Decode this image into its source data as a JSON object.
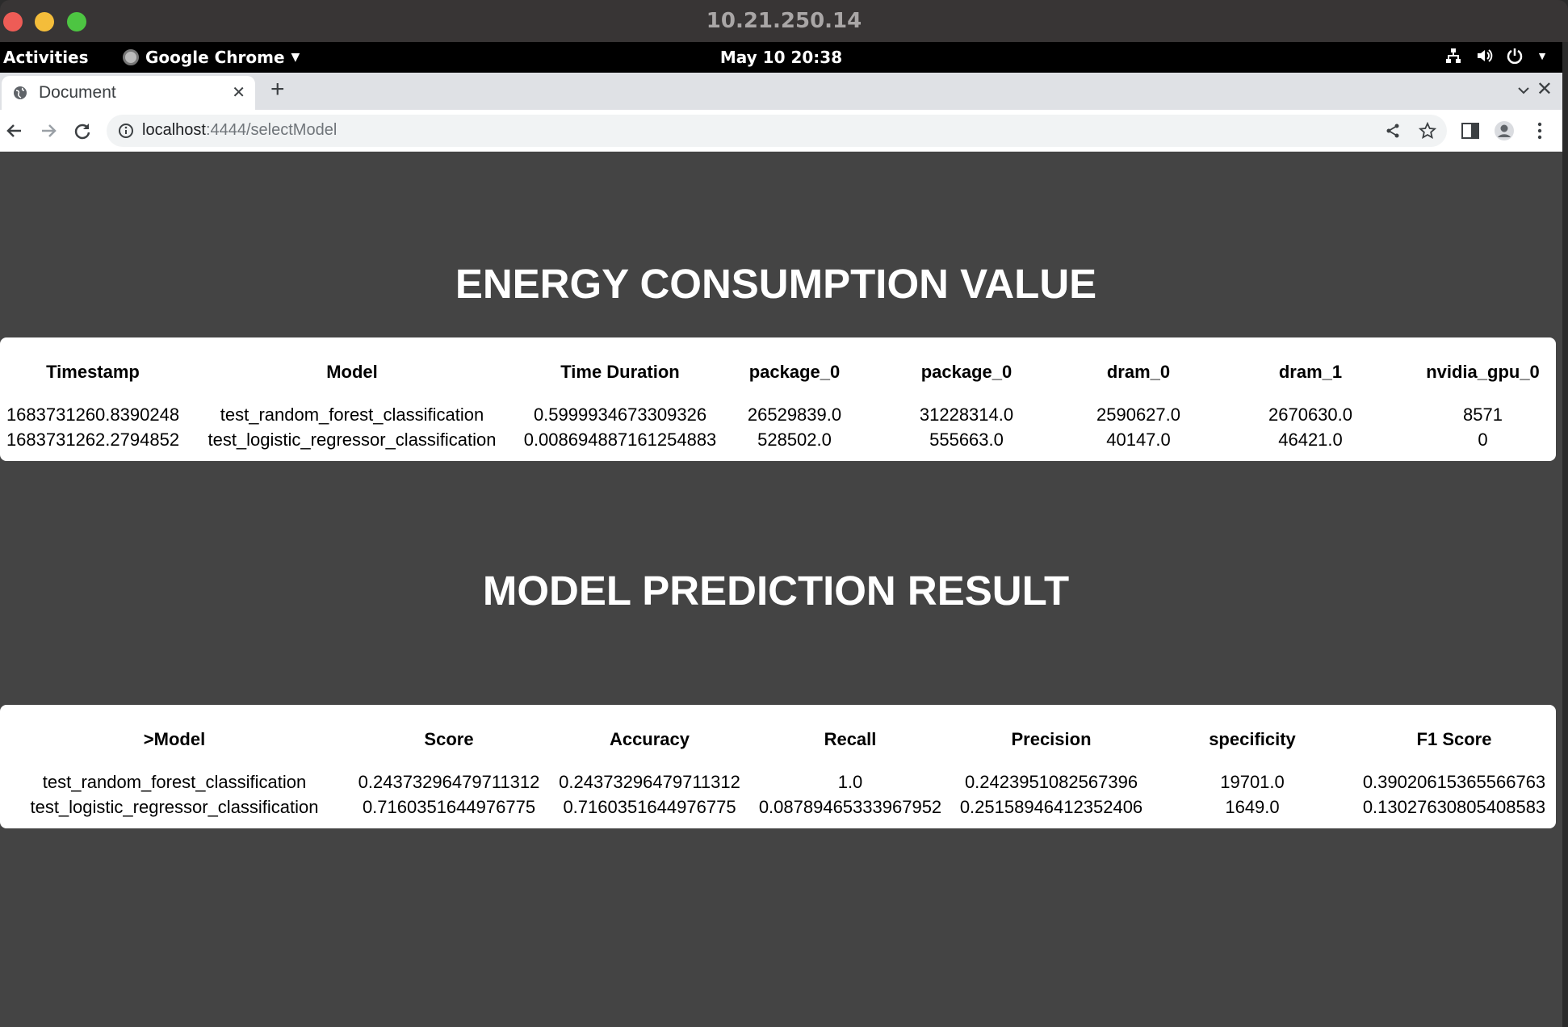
{
  "window": {
    "title": "10.21.250.14"
  },
  "gnome": {
    "activities": "Activities",
    "app_name": "Google Chrome",
    "clock": "May 10  20:38"
  },
  "browser": {
    "tab_title": "Document",
    "url_host": "localhost",
    "url_rest": ":4444/selectModel"
  },
  "energy": {
    "heading": "ENERGY CONSUMPTION VALUE",
    "headers": [
      "Timestamp",
      "Model",
      "Time Duration",
      "package_0",
      "package_0",
      "dram_0",
      "dram_1",
      "nvidia_gpu_0"
    ],
    "rows": [
      [
        "1683731260.8390248",
        "test_random_forest_classification",
        "0.5999934673309326",
        "26529839.0",
        "31228314.0",
        "2590627.0",
        "2670630.0",
        "8571"
      ],
      [
        "1683731262.2794852",
        "test_logistic_regressor_classification",
        "0.008694887161254883",
        "528502.0",
        "555663.0",
        "40147.0",
        "46421.0",
        "0"
      ]
    ]
  },
  "prediction": {
    "heading": "MODEL PREDICTION RESULT",
    "headers": [
      ">Model",
      "Score",
      "Accuracy",
      "Recall",
      "Precision",
      "specificity",
      "F1 Score"
    ],
    "rows": [
      [
        "test_random_forest_classification",
        "0.24373296479711312",
        "0.24373296479711312",
        "1.0",
        "0.2423951082567396",
        "19701.0",
        "0.39020615365566763"
      ],
      [
        "test_logistic_regressor_classification",
        "0.7160351644976775",
        "0.7160351644976775",
        "0.08789465333967952",
        "0.25158946412352406",
        "1649.0",
        "0.13027630805408583"
      ]
    ]
  }
}
